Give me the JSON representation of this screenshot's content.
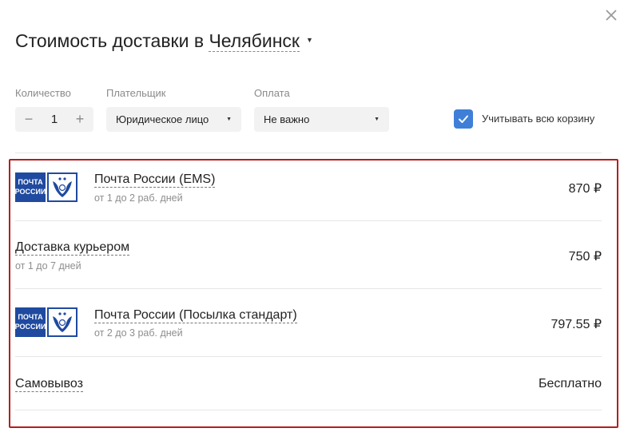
{
  "dialog": {
    "title_prefix": "Стоимость доставки в",
    "city": "Челябинск"
  },
  "filters": {
    "quantity": {
      "label": "Количество",
      "value": "1",
      "minus": "−",
      "plus": "+"
    },
    "payer": {
      "label": "Плательщик",
      "value": "Юридическое лицо"
    },
    "payment": {
      "label": "Оплата",
      "value": "Не важно"
    },
    "whole_cart": {
      "label": "Учитывать всю корзину",
      "checked": true
    }
  },
  "logo_text": {
    "line1": "ПОЧТА",
    "line2": "РОССИИ"
  },
  "options": [
    {
      "name": "Почта России (EMS)",
      "term": "от 1 до 2 раб. дней",
      "price": "870 ₽",
      "logo": "russian-post-logo"
    },
    {
      "name": "Доставка курьером",
      "term": "от 1 до 7 дней",
      "price": "750 ₽"
    },
    {
      "name": "Почта России (Посылка стандарт)",
      "term": "от 2 до 3 раб. дней",
      "price": "797.55 ₽",
      "logo": "russian-post-logo"
    },
    {
      "name": "Самовывоз",
      "price": "Бесплатно"
    }
  ],
  "colors": {
    "accent": "#3f7fd8",
    "highlight_border": "#b41e1e",
    "post_blue": "#1f4aa0"
  },
  "icons": {
    "close": "close-icon",
    "caret": "caret-down-icon",
    "check": "check-icon"
  }
}
